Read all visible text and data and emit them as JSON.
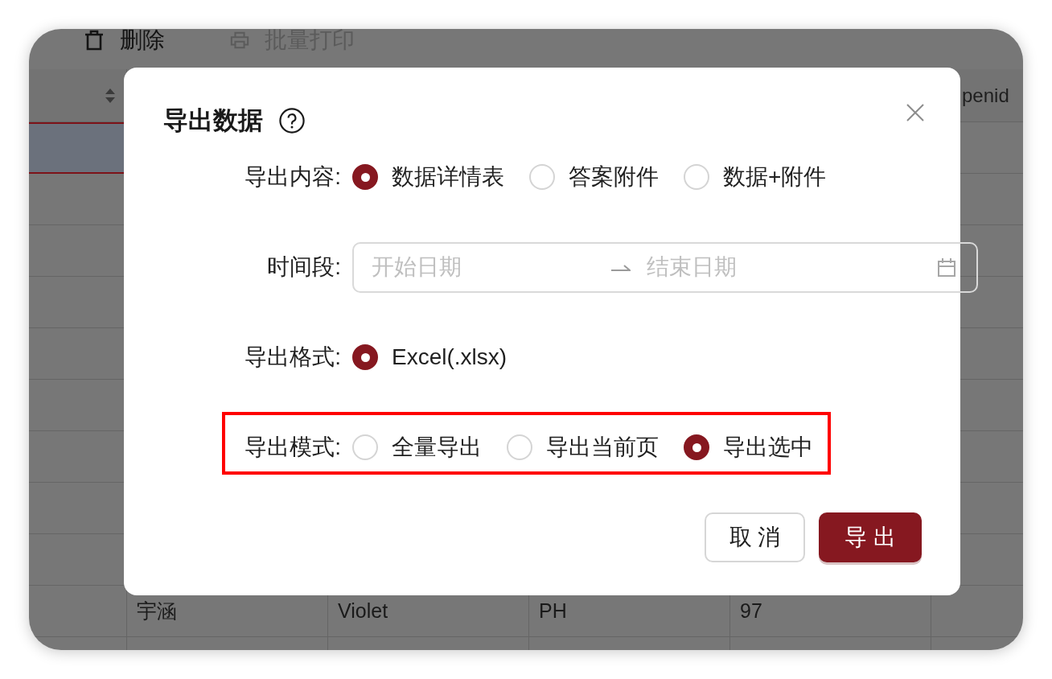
{
  "page": {
    "toolbar": [
      {
        "kind": "delete",
        "label": "删除",
        "disabled": false
      },
      {
        "kind": "print",
        "label": "批量打印",
        "disabled": true
      }
    ],
    "table": {
      "header_text": "penid",
      "rows": [
        {
          "selected": true
        },
        {
          "selected": false
        },
        {
          "selected": false
        },
        {
          "selected": false
        },
        {
          "selected": false
        },
        {
          "selected": false
        },
        {
          "selected": false
        },
        {
          "selected": false
        },
        {
          "selected": false
        },
        {
          "selected": false,
          "cells": [
            "宇涵",
            "Violet",
            "PH",
            "97"
          ]
        },
        {
          "selected": false
        }
      ]
    }
  },
  "dialog": {
    "title": "导出数据",
    "fields": [
      {
        "kind": "radio",
        "label": "导出内容:",
        "highlighted": false,
        "options": [
          {
            "label": "数据详情表",
            "selected": true
          },
          {
            "label": "答案附件",
            "selected": false
          },
          {
            "label": "数据+附件",
            "selected": false
          }
        ]
      },
      {
        "kind": "date_range",
        "label": "时间段:",
        "highlighted": false,
        "start_placeholder": "开始日期",
        "end_placeholder": "结束日期"
      },
      {
        "kind": "radio",
        "label": "导出格式:",
        "highlighted": false,
        "options": [
          {
            "label": "Excel(.xlsx)",
            "selected": true
          }
        ]
      },
      {
        "kind": "radio",
        "label": "导出模式:",
        "highlighted": true,
        "options": [
          {
            "label": "全量导出",
            "selected": false
          },
          {
            "label": "导出当前页",
            "selected": false
          },
          {
            "label": "导出选中",
            "selected": true
          }
        ]
      }
    ],
    "buttons": [
      {
        "kind": "secondary",
        "label": "取 消"
      },
      {
        "kind": "primary",
        "label": "导 出"
      }
    ]
  }
}
